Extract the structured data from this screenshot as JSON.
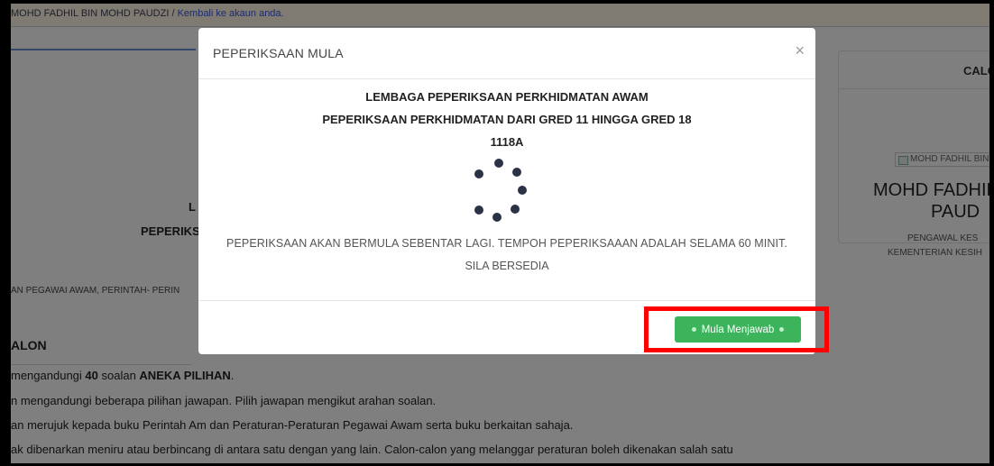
{
  "topbar": {
    "user_text": "MOHD FADHIL BIN MOHD PAUDZI",
    "separator": " / ",
    "link_text": "Kembali ke akaun anda."
  },
  "background": {
    "title_fragment_1": "L",
    "title_fragment_2": "PEPERIKS",
    "rules_line": "AN PEGAWAI AWAM, PERINTAH- PERIN",
    "section_heading": "ALON",
    "instructions": [
      {
        "pre": "mengandungi ",
        "bold1": "40",
        "mid": " soalan ",
        "bold2": "ANEKA PILIHAN",
        "post": "."
      },
      {
        "text": "n mengandungi beberapa pilihan jawapan. Pilih jawapan mengikut arahan soalan."
      },
      {
        "text": "an merujuk kepada buku Perintah Am dan Peraturan-Peraturan Pegawai Awam serta buku berkaitan sahaja."
      },
      {
        "text": "ak dibenarkan meniru atau berbincang di antara satu dengan yang lain. Calon-calon yang melanggar peraturan boleh dikenakan salah satu"
      }
    ]
  },
  "candidate_card": {
    "header": "CALO",
    "image_alt": "MOHD FADHIL BIN",
    "name_line1": "MOHD FADHIL",
    "name_line2": "PAUD",
    "role_line1": "PENGAWAL KES",
    "role_line2": "KEMENTERIAN KESIH"
  },
  "modal": {
    "title": "PEPERIKSAAN MULA",
    "close_symbol": "×",
    "heading1": "LEMBAGA PEPERIKSAAN PERKHIDMATAN AWAM",
    "heading2": "PEPERIKSAAN PERKHIDMATAN DARI GRED 11 HINGGA GRED 18",
    "heading3": "1118A",
    "message1": "PEPERIKSAAN AKAN BERMULA SEBENTAR LAGI. TEMPOH PEPERIKSAAAN ADALAH SELAMA 60 MINIT.",
    "message2": "SILA BERSEDIA",
    "start_button_label": "Mula Menjawab"
  },
  "colors": {
    "button_green": "#3cb45c",
    "highlight_red": "#ff0000",
    "overlay": "rgba(0,0,0,0.5)"
  }
}
